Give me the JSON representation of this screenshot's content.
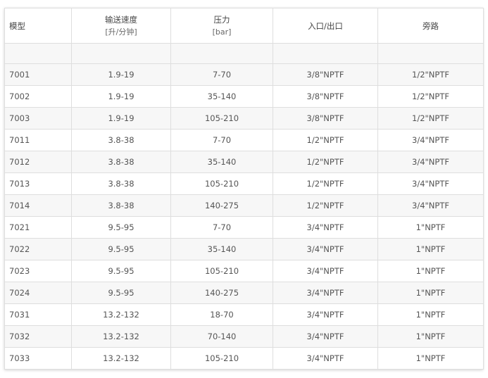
{
  "headers": [
    {
      "label": "模型",
      "unit": ""
    },
    {
      "label": "输送速度",
      "unit": "[升/分钟]"
    },
    {
      "label": "压力",
      "unit": "[bar]"
    },
    {
      "label": "入口/出口",
      "unit": ""
    },
    {
      "label": "旁路",
      "unit": ""
    }
  ],
  "rows": [
    [
      "7001",
      "1.9-19",
      "7-70",
      "3/8\"NPTF",
      "1/2\"NPTF"
    ],
    [
      "7002",
      "1.9-19",
      "35-140",
      "3/8\"NPTF",
      "1/2\"NPTF"
    ],
    [
      "7003",
      "1.9-19",
      "105-210",
      "3/8\"NPTF",
      "1/2\"NPTF"
    ],
    [
      "7011",
      "3.8-38",
      "7-70",
      "1/2\"NPTF",
      "3/4\"NPTF"
    ],
    [
      "7012",
      "3.8-38",
      "35-140",
      "1/2\"NPTF",
      "3/4\"NPTF"
    ],
    [
      "7013",
      "3.8-38",
      "105-210",
      "1/2\"NPTF",
      "3/4\"NPTF"
    ],
    [
      "7014",
      "3.8-38",
      "140-275",
      "1/2\"NPTF",
      "3/4\"NPTF"
    ],
    [
      "7021",
      "9.5-95",
      "7-70",
      "3/4\"NPTF",
      "1\"NPTF"
    ],
    [
      "7022",
      "9.5-95",
      "35-140",
      "3/4\"NPTF",
      "1\"NPTF"
    ],
    [
      "7023",
      "9.5-95",
      "105-210",
      "3/4\"NPTF",
      "1\"NPTF"
    ],
    [
      "7024",
      "9.5-95",
      "140-275",
      "3/4\"NPTF",
      "1\"NPTF"
    ],
    [
      "7031",
      "13.2-132",
      "18-70",
      "3/4\"NPTF",
      "1\"NPTF"
    ],
    [
      "7032",
      "13.2-132",
      "70-140",
      "3/4\"NPTF",
      "1\"NPTF"
    ],
    [
      "7033",
      "13.2-132",
      "105-210",
      "3/4\"NPTF",
      "1\"NPTF"
    ]
  ],
  "colors": {
    "border": "#dedede",
    "stripe": "#f7f7f7",
    "text": "#555555"
  }
}
